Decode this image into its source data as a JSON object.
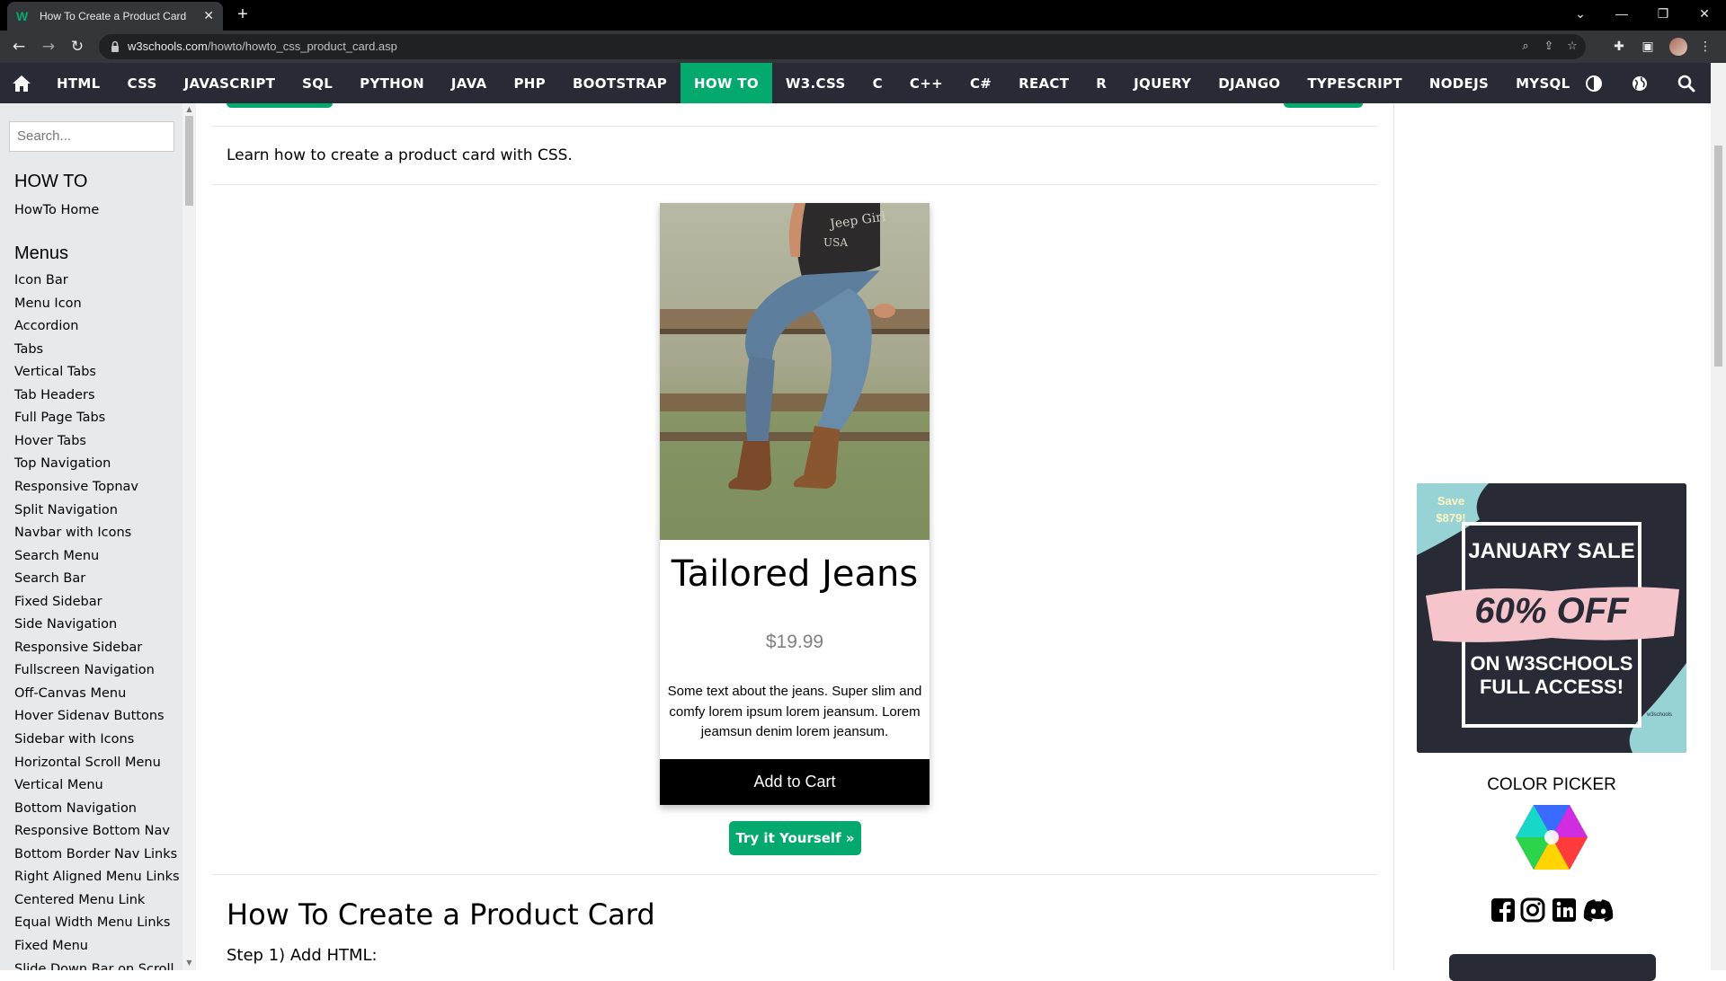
{
  "browser": {
    "tab_title": "How To Create a Product Card",
    "tab_favicon": "w3",
    "url_host": "w3schools.com",
    "url_path": "/howto/howto_css_product_card.asp",
    "new_tab": "+",
    "win_min": "—",
    "win_max": "❐",
    "win_close": "✕",
    "win_dropdown": "⌄"
  },
  "topnav": {
    "items": [
      "HTML",
      "CSS",
      "JAVASCRIPT",
      "SQL",
      "PYTHON",
      "JAVA",
      "PHP",
      "BOOTSTRAP",
      "HOW TO",
      "W3.CSS",
      "C",
      "C++",
      "C#",
      "REACT",
      "R",
      "JQUERY",
      "DJANGO",
      "TYPESCRIPT",
      "NODEJS",
      "MYSQL"
    ],
    "active": "HOW TO",
    "accent": "#04aa6d",
    "bg": "#282a35"
  },
  "sidebar": {
    "search_placeholder": "Search...",
    "heading1": "HOW TO",
    "home_link": "HowTo Home",
    "heading2": "Menus",
    "links": [
      "Icon Bar",
      "Menu Icon",
      "Accordion",
      "Tabs",
      "Vertical Tabs",
      "Tab Headers",
      "Full Page Tabs",
      "Hover Tabs",
      "Top Navigation",
      "Responsive Topnav",
      "Split Navigation",
      "Navbar with Icons",
      "Search Menu",
      "Search Bar",
      "Fixed Sidebar",
      "Side Navigation",
      "Responsive Sidebar",
      "Fullscreen Navigation",
      "Off-Canvas Menu",
      "Hover Sidenav Buttons",
      "Sidebar with Icons",
      "Horizontal Scroll Menu",
      "Vertical Menu",
      "Bottom Navigation",
      "Responsive Bottom Nav",
      "Bottom Border Nav Links",
      "Right Aligned Menu Links",
      "Centered Menu Link",
      "Equal Width Menu Links",
      "Fixed Menu",
      "Slide Down Bar on Scroll"
    ]
  },
  "main": {
    "intro": "Learn how to create a product card with CSS.",
    "card": {
      "title": "Tailored Jeans",
      "price": "$19.99",
      "description": "Some text about the jeans. Super slim and comfy lorem ipsum lorem jeansum. Lorem jeamsun denim lorem jeansum.",
      "button": "Add to Cart"
    },
    "try_button": "Try it Yourself »",
    "heading": "How To Create a Product Card",
    "step": "Step 1) Add HTML:"
  },
  "right": {
    "ad": {
      "save": "Save\n$879!",
      "line1": "JANUARY SALE",
      "line2": "60% OFF",
      "line3": "ON W3SCHOOLS",
      "line4": "FULL ACCESS!",
      "brand": "w3schools"
    },
    "color_picker_label": "COLOR PICKER"
  }
}
